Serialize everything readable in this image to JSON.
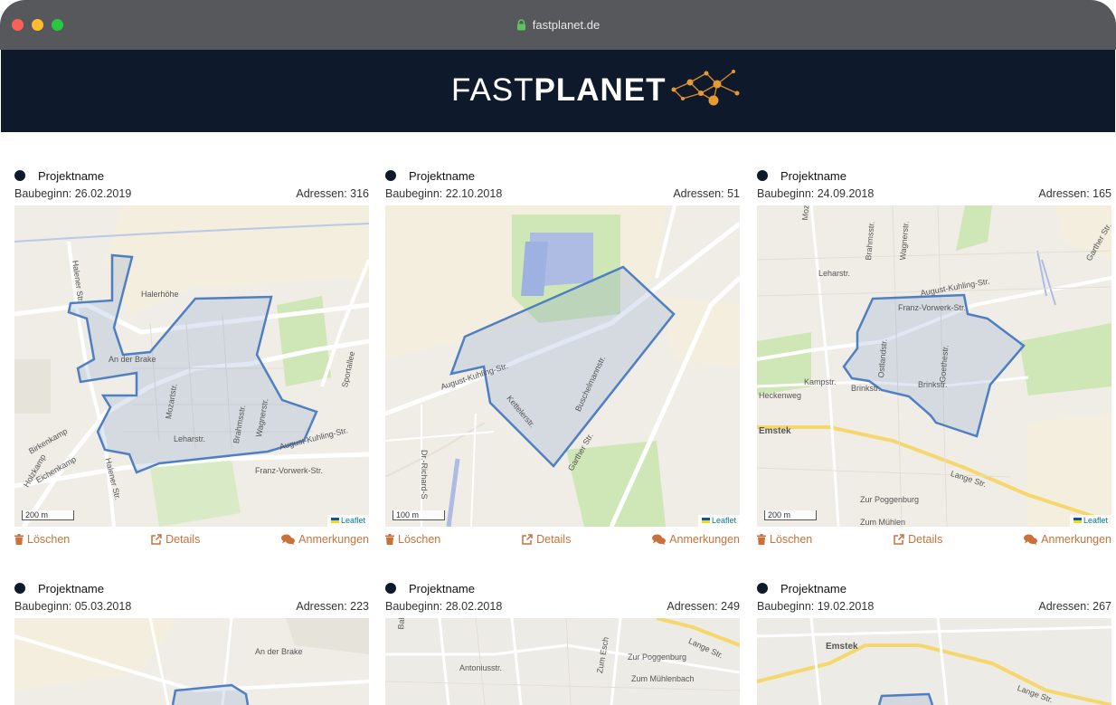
{
  "browser": {
    "url": "fastplanet.de"
  },
  "header": {
    "logo_fast": "FAST",
    "logo_planet": "PLANET"
  },
  "actions": {
    "delete": "Löschen",
    "details": "Details",
    "comments": "Anmerkungen"
  },
  "map_attribution": "Leaflet",
  "cards": [
    {
      "name": "Projektname",
      "start": "Baubeginn: 26.02.2019",
      "addresses": "Adressen: 316",
      "scale": "200 m",
      "streets": [
        "Halener Str.",
        "Halerhöhe",
        "An der Brake",
        "Mozartstr.",
        "Brahmsstr.",
        "Wagnerstr.",
        "Leharstr.",
        "August-Kuhling-Str.",
        "Sportallee",
        "Franz-Vorwerk-Str.",
        "Birkenkamp",
        "Eichenkamp",
        "Holzkamp",
        "Halener Str."
      ]
    },
    {
      "name": "Projektname",
      "start": "Baubeginn: 22.10.2018",
      "addresses": "Adressen: 51",
      "scale": "100 m",
      "streets": [
        "August-Kuhling-Str.",
        "Kettelerstr.",
        "Buschelmannstr.",
        "Garther Str.",
        "Dr.-Richard-S"
      ]
    },
    {
      "name": "Projektname",
      "start": "Baubeginn: 24.09.2018",
      "addresses": "Adressen: 165",
      "scale": "200 m",
      "streets": [
        "Mozartstr.",
        "Brahmsstr.",
        "Wagnerstr.",
        "Leharstr.",
        "August-Kuhling-Str.",
        "Franz-Vorwerk-Str.",
        "Ostlandstr.",
        "Goethestr.",
        "Kampstr.",
        "Brinkstr.",
        "Brinkstr.",
        "Emstek",
        "Lange Str.",
        "Zur Poggenburg",
        "Zum Mühlen",
        "Heckenweg",
        "Garther Str."
      ]
    },
    {
      "name": "Projektname",
      "start": "Baubeginn: 05.03.2018",
      "addresses": "Adressen: 223",
      "streets": [
        "An der Brake"
      ]
    },
    {
      "name": "Projektname",
      "start": "Baubeginn: 28.02.2018",
      "addresses": "Adressen: 249",
      "streets": [
        "Zur Poggenburg",
        "Antoniusstr.",
        "Bahnhofstr.",
        "Zum Esch",
        "Zum Mühlenbach",
        "Lange Str."
      ]
    },
    {
      "name": "Projektname",
      "start": "Baubeginn: 19.02.2018",
      "addresses": "Adressen: 267",
      "streets": [
        "Emstek",
        "Lange Str."
      ]
    }
  ]
}
